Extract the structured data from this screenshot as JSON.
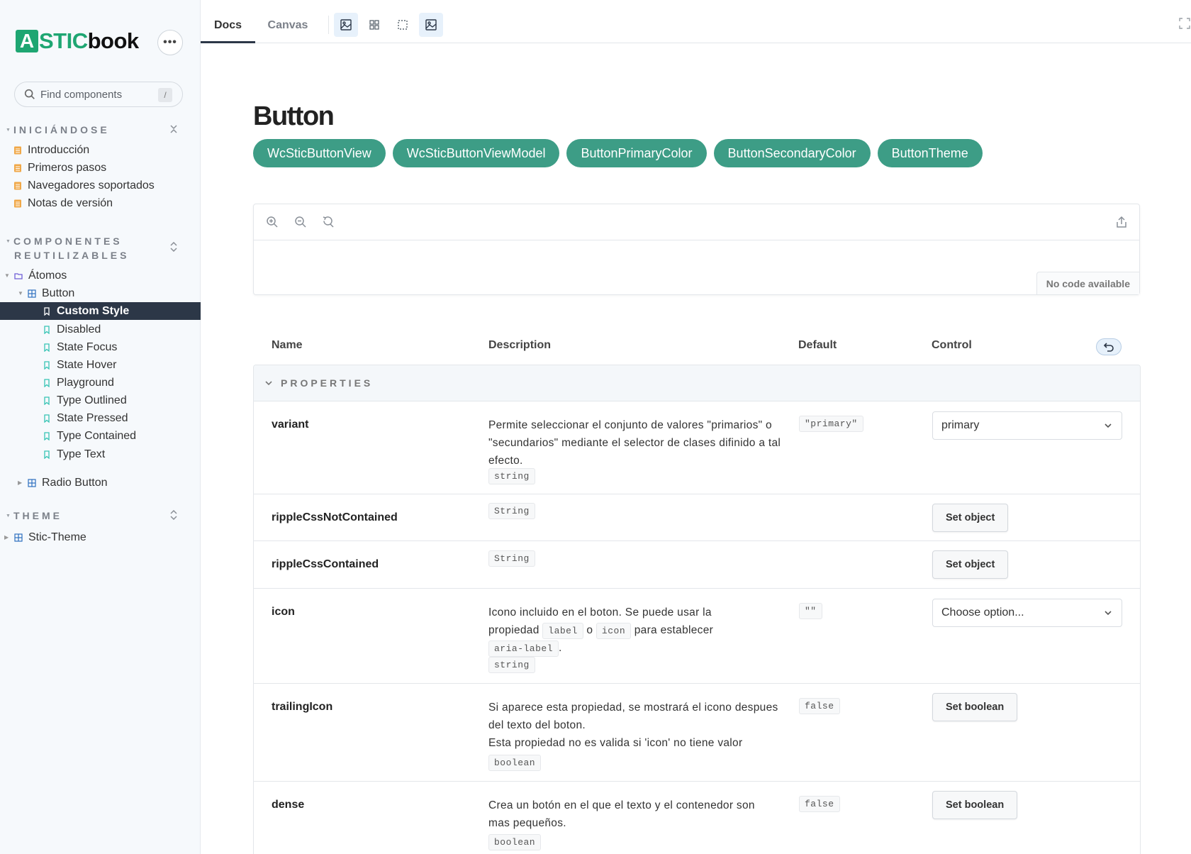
{
  "brand": {
    "mark": "A",
    "stic": "STIC",
    "book": "book"
  },
  "sidebar": {
    "menu_glyph": "•••",
    "search": {
      "placeholder": "Find components",
      "shortcut": "/"
    },
    "sections": [
      {
        "title": "INICIÁNDOSE",
        "items": [
          "Introducción",
          "Primeros pasos",
          "Navegadores soportados",
          "Notas de versión"
        ]
      },
      {
        "title": "COMPONENTES",
        "title2": "REUTILIZABLES"
      },
      {
        "title": "THEME"
      }
    ],
    "tree": {
      "folder": "Átomos",
      "component": "Button",
      "stories": [
        "Custom Style",
        "Disabled",
        "State Focus",
        "State Hover",
        "Playground",
        "Type Outlined",
        "State Pressed",
        "Type Contained",
        "Type Text"
      ],
      "radio": "Radio Button",
      "theme": "Stic-Theme"
    },
    "selected": "Custom Style"
  },
  "toolbar": {
    "tabs": [
      "Docs",
      "Canvas"
    ],
    "active_tab": "Docs",
    "tools": [
      "image-icon",
      "grid-icon",
      "outline-icon",
      "image-icon"
    ]
  },
  "main": {
    "title": "Button",
    "chips": [
      "WcSticButtonView",
      "WcSticButtonViewModel",
      "ButtonPrimaryColor",
      "ButtonSecondaryColor",
      "ButtonTheme"
    ],
    "canvas": {
      "no_code": "No code available"
    },
    "table": {
      "headers": [
        "Name",
        "Description",
        "Default",
        "Control"
      ],
      "group": "PROPERTIES",
      "rows": [
        {
          "name": "variant",
          "desc": "Permite seleccionar el conjunto de valores \"primarios\" o \"secundarios\" mediante el selector de clases difinido a tal efecto.",
          "type": "string",
          "default": "\"primary\"",
          "control": "primary"
        },
        {
          "name": "rippleCssNotContained",
          "type": "String",
          "control": "Set object"
        },
        {
          "name": "rippleCssContained",
          "type": "String",
          "control": "Set object"
        },
        {
          "name": "icon",
          "desc_a": "Icono incluido en el boton. Se puede usar la propiedad",
          "code_a": "label",
          "desc_b": "o",
          "code_b": "icon",
          "desc_c": "para establecer",
          "code_c": "aria-label",
          "desc_d": ".",
          "type": "string",
          "default": "\"\"",
          "control": "Choose option..."
        },
        {
          "name": "trailingIcon",
          "desc_1": "Si aparece esta propiedad, se mostrará el icono despues del texto del boton.",
          "desc_2": "Esta propiedad no es valida si 'icon' no tiene valor",
          "type": "boolean",
          "default": "false",
          "control": "Set boolean"
        },
        {
          "name": "dense",
          "desc": "Crea un botón en el que el texto y el contenedor son mas pequeños.",
          "type": "boolean",
          "default": "false",
          "control": "Set boolean"
        }
      ]
    }
  },
  "colors": {
    "brand": "#1ea672",
    "chip": "#3d9d86",
    "selected": "#2c3747"
  }
}
